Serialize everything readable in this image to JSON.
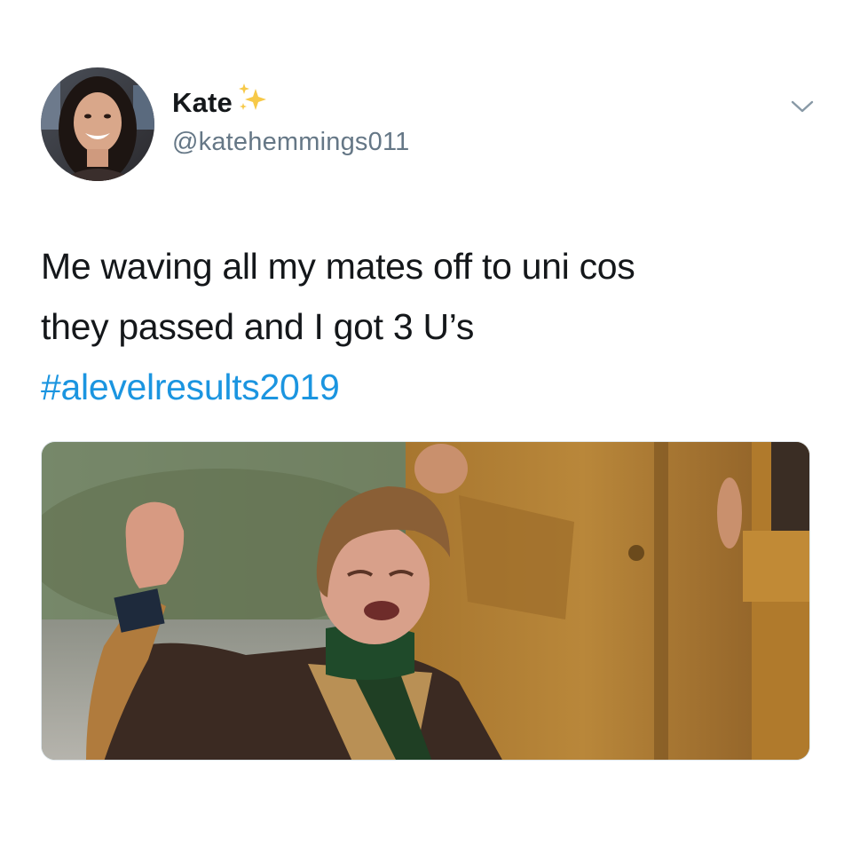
{
  "user": {
    "display_name": "Kate",
    "name_emoji": "sparkles",
    "handle": "@katehemmings011",
    "avatar_icon": "avatar"
  },
  "menu": {
    "icon": "chevron-down-icon"
  },
  "tweet": {
    "line1": "Me waving all my mates off to uni cos",
    "line2": "they passed and I got 3 U’s",
    "hashtag": "#alevelresults2019"
  },
  "colors": {
    "text": "#14171a",
    "secondary": "#657786",
    "link": "#1b95e0",
    "sparkle": "#f7c948"
  }
}
